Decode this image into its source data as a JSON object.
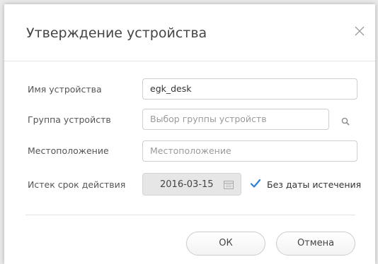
{
  "dialog": {
    "title": "Утверждение устройства"
  },
  "form": {
    "device_name": {
      "label": "Имя устройства",
      "value": "egk_desk"
    },
    "device_group": {
      "label": "Группа устройств",
      "placeholder": "Выбор группы устройств"
    },
    "location": {
      "label": "Местоположение",
      "placeholder": "Местоположение"
    },
    "expiration": {
      "label": "Истек срок действия",
      "date": "2016-03-15",
      "no_expiry_label": "Без даты истечения",
      "no_expiry_checked": true
    }
  },
  "buttons": {
    "ok": "ОК",
    "cancel": "Отмена"
  },
  "colors": {
    "checkbox_accent": "#2f7fd8",
    "text_dark": "#444444",
    "placeholder": "#9a9a9a"
  },
  "icons": {
    "close": "close-icon",
    "search": "search-icon",
    "calendar": "calendar-icon",
    "check": "check-icon"
  }
}
